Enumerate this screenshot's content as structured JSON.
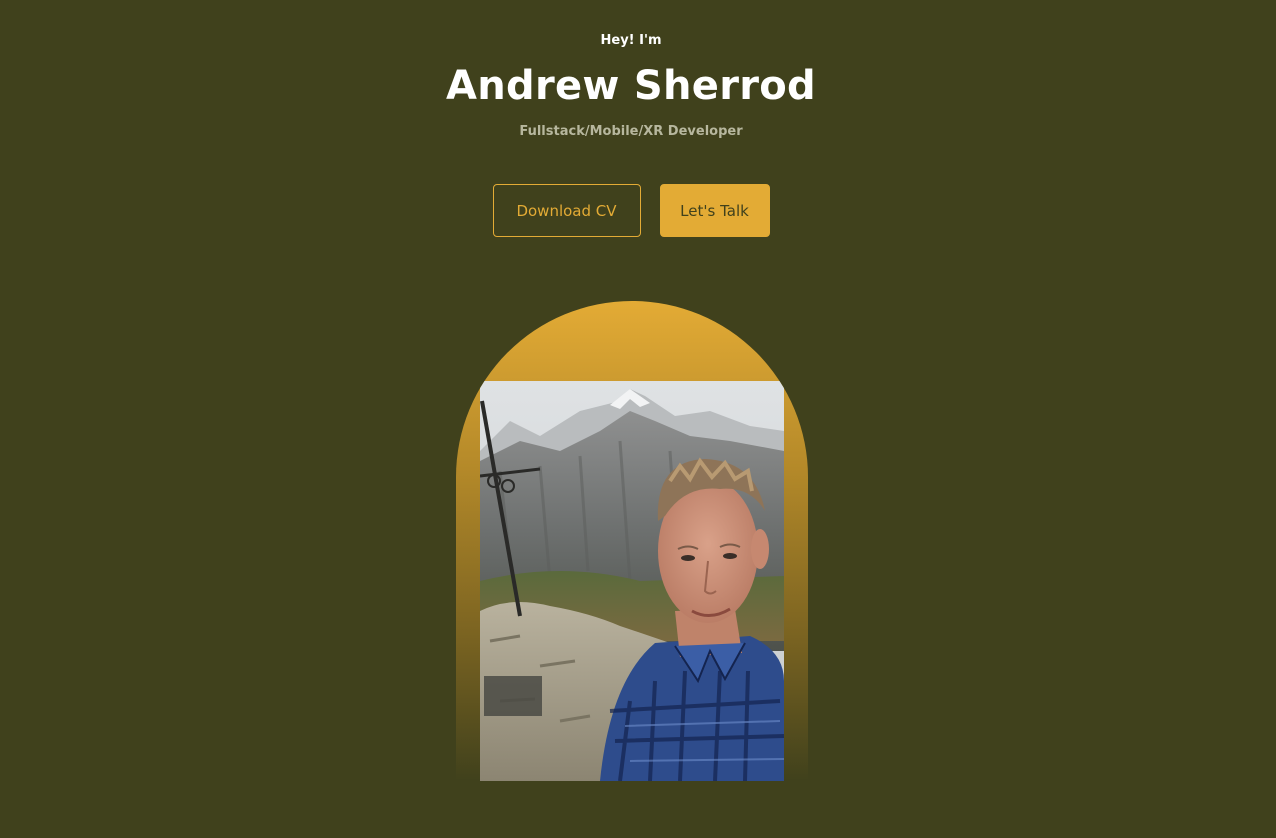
{
  "hero": {
    "greeting": "Hey! I'm",
    "name": "Andrew Sherrod",
    "title": "Fullstack/Mobile/XR Developer"
  },
  "buttons": {
    "download_cv": "Download CV",
    "lets_talk": "Let's Talk"
  },
  "colors": {
    "background": "#40411c",
    "accent": "#e3ab35",
    "subtitle": "#b7b79e"
  }
}
